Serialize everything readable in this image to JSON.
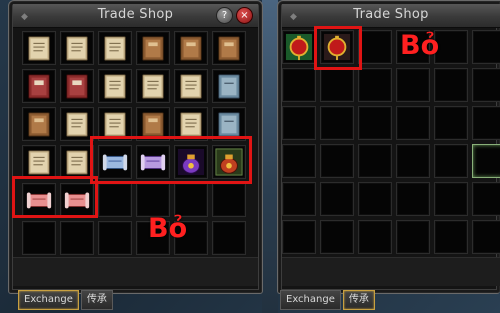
{
  "left_window": {
    "title": "Trade Shop",
    "tabs": [
      {
        "label": "Exchange",
        "active": true
      },
      {
        "label": "传承",
        "active": false
      }
    ],
    "annotation": "Bỏ",
    "rows": [
      [
        "book-tan",
        "book-tan",
        "book-tan",
        "book-brown",
        "book-brown",
        "book-brown"
      ],
      [
        "book-red",
        "book-red",
        "book-tan",
        "book-tan",
        "book-tan",
        "book-blue"
      ],
      [
        "book-brown",
        "book-tan",
        "book-tan",
        "book-brown",
        "book-tan",
        "book-blue"
      ],
      [
        "book-tan",
        "book-tan",
        "scroll-blue",
        "scroll-purple",
        "pouch-purple",
        "pouch-red"
      ],
      [
        "scroll-red",
        "scroll-red",
        "empty",
        "empty",
        "empty",
        "empty"
      ],
      [
        "empty",
        "empty",
        "empty",
        "empty",
        "empty",
        "empty"
      ]
    ]
  },
  "right_window": {
    "title": "Trade Shop",
    "tabs": [
      {
        "label": "Exchange",
        "active": false
      },
      {
        "label": "传承",
        "active": true
      }
    ],
    "annotation": "Bỏ",
    "rows": [
      [
        "lantern-green",
        "lantern-red",
        "empty",
        "empty",
        "empty",
        "empty"
      ],
      [
        "empty",
        "empty",
        "empty",
        "empty",
        "empty",
        "empty"
      ],
      [
        "empty",
        "empty",
        "empty",
        "empty",
        "empty",
        "empty"
      ],
      [
        "empty",
        "empty",
        "empty",
        "empty",
        "empty",
        "empty-lit"
      ],
      [
        "empty",
        "empty",
        "empty",
        "empty",
        "empty",
        "empty"
      ],
      [
        "empty",
        "empty",
        "empty",
        "empty",
        "empty",
        "empty"
      ]
    ]
  },
  "colors": {
    "highlight": "#e01414",
    "annotation_text": "#ff2020",
    "panel": "#141414",
    "title_text": "#d6d6d6"
  }
}
